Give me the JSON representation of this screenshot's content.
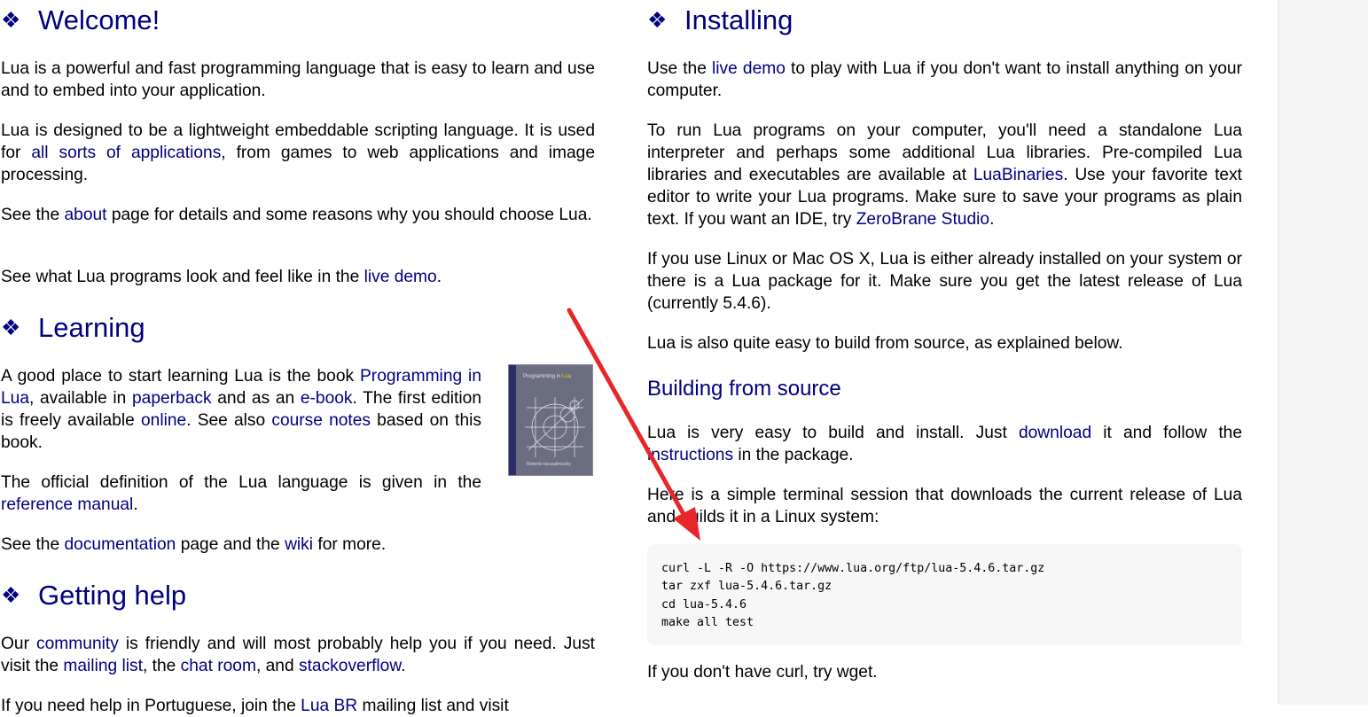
{
  "left": {
    "welcome": {
      "title": "Welcome!",
      "p1": "Lua is a powerful and fast programming language that is easy to learn and use and to embed into your application.",
      "p2_a": "Lua is designed to be a lightweight embeddable scripting language. It is used for ",
      "p2_link": "all sorts of applications",
      "p2_b": ", from games to web applications and image processing.",
      "p3_a": "See the ",
      "p3_link": "about",
      "p3_b": " page for details and some reasons why you should choose Lua.",
      "p4_a": "See what Lua programs look and feel like in the ",
      "p4_link": "live demo",
      "p4_b": "."
    },
    "learning": {
      "title": "Learning",
      "p1_a": "A good place to start learning Lua is the book ",
      "p1_link1": "Programming in Lua",
      "p1_b": ", available in ",
      "p1_link2": "paperback",
      "p1_c": " and as an ",
      "p1_link3": "e-book",
      "p1_d": ". The first edition is freely available ",
      "p1_link4": "online",
      "p1_e": ". See also ",
      "p1_link5": "course notes",
      "p1_f": " based on this book.",
      "p2_a": "The official definition of the Lua language is given in the ",
      "p2_link": "reference manual",
      "p2_b": ".",
      "p3_a": "See the ",
      "p3_link1": "documentation",
      "p3_b": " page and the ",
      "p3_link2": "wiki",
      "p3_c": " for more.",
      "book_title": "Programming in ",
      "book_title_hl": "Lua",
      "book_author": "Roberto Ierusalimschy"
    },
    "help": {
      "title": "Getting help",
      "p1_a": "Our ",
      "p1_link1": "community",
      "p1_b": " is friendly and will most probably help you if you need. Just visit the ",
      "p1_link2": "mailing list",
      "p1_c": ", the ",
      "p1_link3": "chat room",
      "p1_d": ", and ",
      "p1_link4": "stackoverflow",
      "p1_e": ".",
      "p2_a": "If you need help in Portuguese, join the ",
      "p2_link": "Lua BR",
      "p2_b": " mailing list and visit"
    }
  },
  "right": {
    "installing": {
      "title": "Installing",
      "p1_a": "Use the ",
      "p1_link": "live demo",
      "p1_b": " to play with Lua if you don't want to install anything on your computer.",
      "p2_a": "To run Lua programs on your computer, you'll need a standalone Lua interpreter and perhaps some additional Lua libraries. Pre-compiled Lua libraries and executables are available at ",
      "p2_link1": "LuaBinaries",
      "p2_b": ". Use your favorite text editor to write your Lua programs. Make sure to save your programs as plain text. If you want an IDE, try ",
      "p2_link2": "ZeroBrane Studio",
      "p2_c": ".",
      "p3": "If you use Linux or Mac OS X, Lua is either already installed on your system or there is a Lua package for it. Make sure you get the latest release of Lua (currently 5.4.6).",
      "p4": "Lua is also quite easy to build from source, as explained below."
    },
    "building": {
      "title": "Building from source",
      "p1_a": "Lua is very easy to build and install. Just ",
      "p1_link1": "download",
      "p1_b": " it and follow the ",
      "p1_link2": "instructions",
      "p1_c": " in the package.",
      "p2": "Here is a simple terminal session that downloads the current release of Lua and builds it in a Linux system:",
      "code": "curl -L -R -O https://www.lua.org/ftp/lua-5.4.6.tar.gz\ntar zxf lua-5.4.6.tar.gz\ncd lua-5.4.6\nmake all test",
      "p3": "If you don't have curl, try wget."
    }
  },
  "bullet": "❖",
  "colors": {
    "link": "#000080",
    "heading": "#000080",
    "annotation_arrow": "#e8262a",
    "code_bg": "#f7f7f7"
  }
}
